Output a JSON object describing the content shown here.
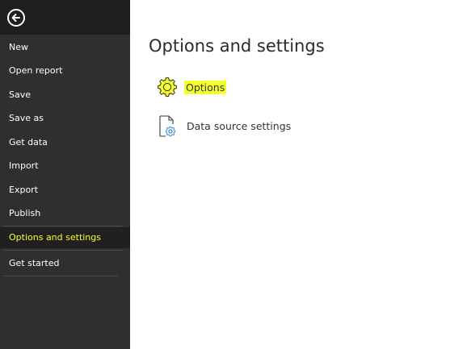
{
  "sidebar": {
    "back_icon": "back-arrow-icon",
    "items": [
      {
        "label": "New"
      },
      {
        "label": "Open report"
      },
      {
        "label": "Save"
      },
      {
        "label": "Save as"
      },
      {
        "label": "Get data"
      },
      {
        "label": "Import"
      },
      {
        "label": "Export"
      },
      {
        "label": "Publish"
      },
      {
        "label": "Options and settings",
        "selected": true
      },
      {
        "label": "Get started"
      }
    ]
  },
  "main": {
    "title": "Options and settings",
    "options": [
      {
        "label": "Options",
        "icon": "gear-icon",
        "highlighted": true
      },
      {
        "label": "Data source settings",
        "icon": "data-source-settings-icon"
      }
    ]
  },
  "colors": {
    "sidebar_bg": "#2f2f2f",
    "sidebar_header_bg": "#1f1f1f",
    "selected_bg": "#202020",
    "highlight": "#f5ff2e",
    "selected_text": "#f6ff2a"
  }
}
